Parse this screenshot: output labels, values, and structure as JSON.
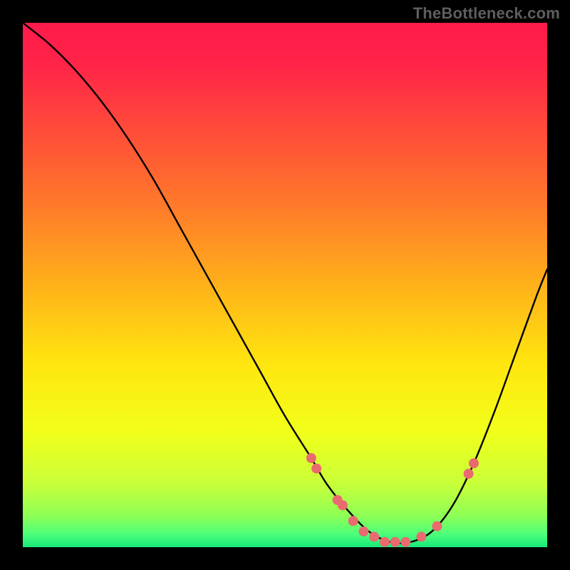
{
  "watermark": "TheBottleneck.com",
  "gradient": {
    "stops": [
      {
        "offset": 0.0,
        "color": "#ff1a4b"
      },
      {
        "offset": 0.08,
        "color": "#ff2448"
      },
      {
        "offset": 0.2,
        "color": "#ff4a3a"
      },
      {
        "offset": 0.35,
        "color": "#ff7a2a"
      },
      {
        "offset": 0.5,
        "color": "#ffb11a"
      },
      {
        "offset": 0.65,
        "color": "#ffe60f"
      },
      {
        "offset": 0.78,
        "color": "#f2ff1a"
      },
      {
        "offset": 0.88,
        "color": "#c8ff3a"
      },
      {
        "offset": 0.94,
        "color": "#8dff55"
      },
      {
        "offset": 0.975,
        "color": "#4dff7a"
      },
      {
        "offset": 1.0,
        "color": "#15e87a"
      }
    ]
  },
  "chart_data": {
    "type": "line",
    "title": "",
    "xlabel": "",
    "ylabel": "",
    "xlim": [
      0,
      100
    ],
    "ylim": [
      0,
      100
    ],
    "series": [
      {
        "name": "bottleneck-curve",
        "x": [
          0,
          5,
          10,
          15,
          20,
          25,
          30,
          35,
          40,
          45,
          50,
          55,
          58,
          62,
          66,
          70,
          74,
          78,
          82,
          86,
          90,
          94,
          98,
          100
        ],
        "y": [
          100,
          96,
          91,
          85,
          78,
          70,
          61,
          52,
          43,
          34,
          25,
          17,
          12,
          7,
          3,
          1,
          1,
          3,
          8,
          16,
          26,
          37,
          48,
          53
        ]
      }
    ],
    "markers": {
      "name": "highlight-points",
      "color": "#e96a6f",
      "radius": 7,
      "points": [
        {
          "x": 55,
          "y": 17
        },
        {
          "x": 56,
          "y": 15
        },
        {
          "x": 60,
          "y": 9
        },
        {
          "x": 61,
          "y": 8
        },
        {
          "x": 63,
          "y": 5
        },
        {
          "x": 65,
          "y": 3
        },
        {
          "x": 67,
          "y": 2
        },
        {
          "x": 69,
          "y": 1
        },
        {
          "x": 71,
          "y": 1
        },
        {
          "x": 73,
          "y": 1
        },
        {
          "x": 76,
          "y": 2
        },
        {
          "x": 79,
          "y": 4
        },
        {
          "x": 85,
          "y": 14
        },
        {
          "x": 86,
          "y": 16
        }
      ]
    }
  }
}
